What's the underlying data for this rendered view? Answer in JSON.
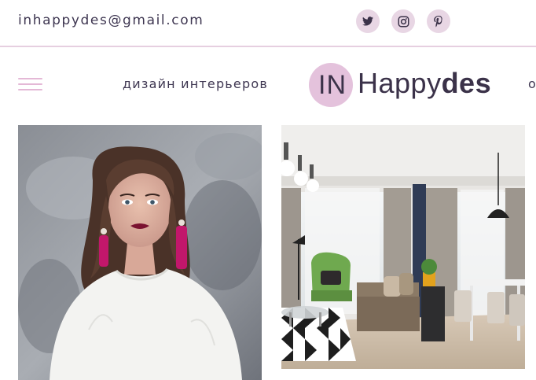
{
  "header": {
    "email": "inhappydes@gmail.com",
    "social": [
      {
        "name": "twitter",
        "icon": "twitter-icon"
      },
      {
        "name": "instagram",
        "icon": "instagram-icon"
      },
      {
        "name": "pinterest",
        "icon": "pinterest-icon"
      }
    ]
  },
  "nav": {
    "items": [
      "дизайн интерьеров",
      "о"
    ]
  },
  "logo": {
    "prefix": "IN",
    "word_main": "Happy",
    "word_bold": "des"
  },
  "gallery": [
    {
      "name": "portrait-photo",
      "alt": ""
    },
    {
      "name": "living-room-photo",
      "alt": ""
    }
  ],
  "colors": {
    "accent_pink": "#e4c2dc",
    "text_dark": "#3b3249",
    "divider": "#e6cfe0"
  }
}
